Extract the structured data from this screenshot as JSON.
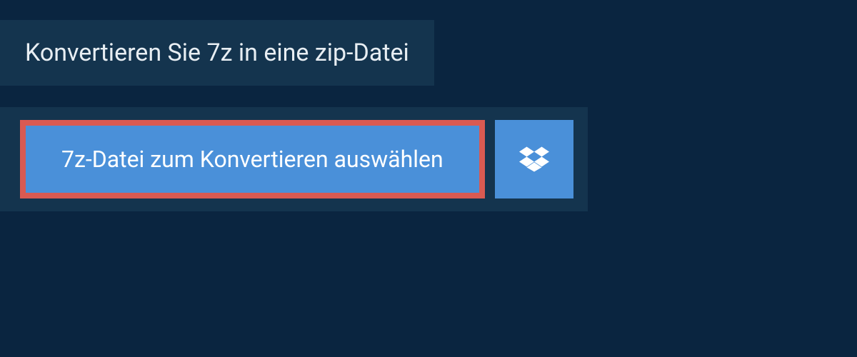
{
  "header": {
    "title": "Konvertieren Sie 7z in eine zip-Datei"
  },
  "buttons": {
    "select_file_label": "7z-Datei zum Konvertieren auswählen",
    "dropbox_icon_name": "dropbox-icon"
  },
  "colors": {
    "background": "#0a2540",
    "panel": "#14344e",
    "button_primary": "#4a90d9",
    "highlight_border": "#d95a52",
    "text_light": "#e8eef3",
    "text_white": "#ffffff"
  }
}
